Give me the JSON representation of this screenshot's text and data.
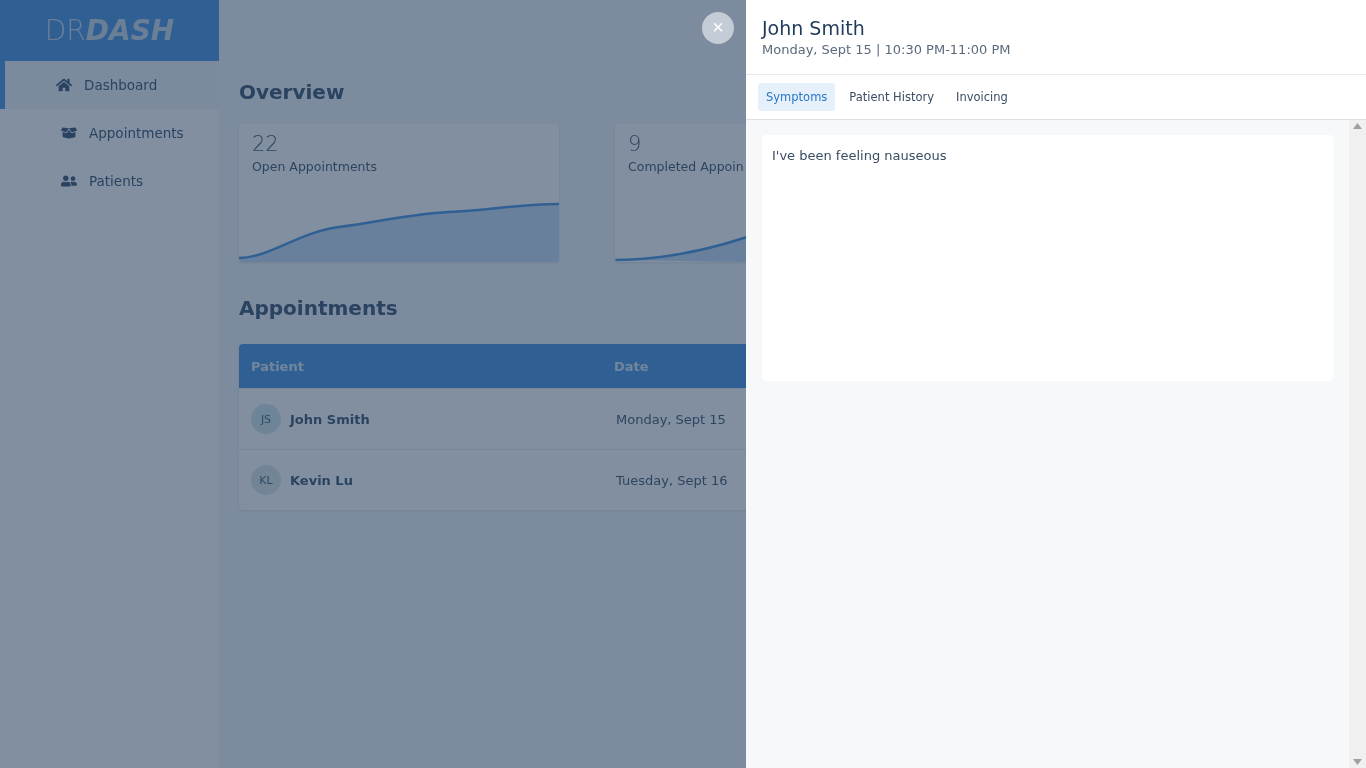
{
  "logo": {
    "light": "DR",
    "bold": "DASH"
  },
  "sidebar": {
    "items": [
      {
        "label": "Dashboard",
        "selected": true
      },
      {
        "label": "Appointments",
        "selected": false
      },
      {
        "label": "Patients",
        "selected": false
      }
    ]
  },
  "overview": {
    "title": "Overview",
    "cards": [
      {
        "count": "22",
        "label": "Open Appointments",
        "kind": "plateau"
      },
      {
        "count": "9",
        "label": "Completed Appoin",
        "kind": "rising"
      }
    ]
  },
  "appointments": {
    "title": "Appointments",
    "columns": [
      "Patient",
      "Date"
    ],
    "rows": [
      {
        "initials": "JS",
        "name": "John Smith",
        "date": "Monday, Sept 15"
      },
      {
        "initials": "KL",
        "name": "Kevin Lu",
        "date": "Tuesday, Sept 16"
      }
    ]
  },
  "drawer": {
    "close": "×",
    "title": "John Smith",
    "subtitle": "Monday, Sept 15 | 10:30 PM-11:00 PM",
    "tabs": [
      {
        "label": "Symptoms",
        "selected": true
      },
      {
        "label": "Patient History",
        "selected": false
      },
      {
        "label": "Invoicing",
        "selected": false
      }
    ],
    "symptoms": "I've been feeling nauseous"
  }
}
